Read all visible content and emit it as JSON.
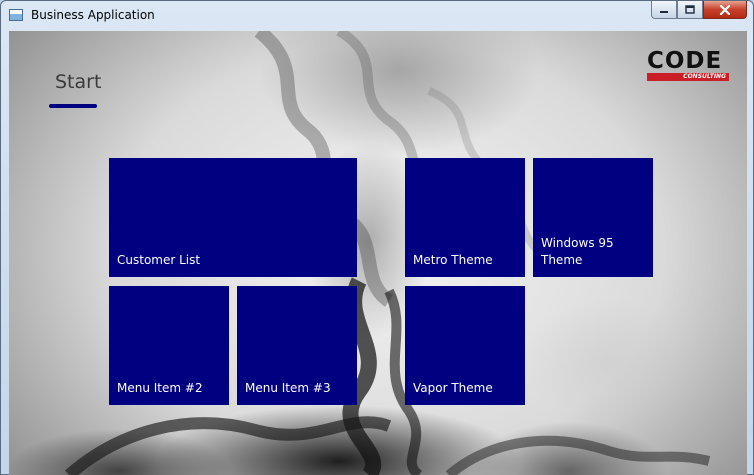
{
  "window": {
    "title": "Business Application",
    "buttons": {
      "minimize": "minimize-icon",
      "maximize": "maximize-icon",
      "close": "close-icon"
    }
  },
  "start": {
    "heading": "Start"
  },
  "logo": {
    "word": "CODE",
    "sub": "CONSULTING",
    "brand_color": "#cc1e26"
  },
  "tiles": {
    "customer_list": "Customer List",
    "metro_theme": "Metro Theme",
    "windows95_theme": "Windows 95 Theme",
    "menu_item_2": "Menu Item #2",
    "menu_item_3": "Menu Item #3",
    "vapor_theme": "Vapor Theme"
  },
  "colors": {
    "tile": "#000080",
    "accent": "#000080"
  }
}
